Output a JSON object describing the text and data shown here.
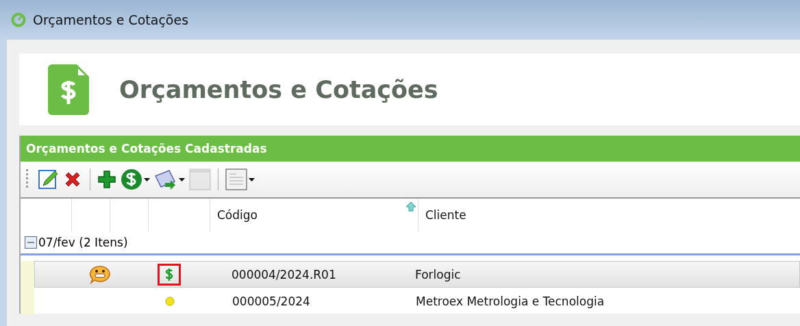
{
  "window": {
    "title": "Orçamentos e Cotações"
  },
  "header": {
    "title": "Orçamentos e Cotações"
  },
  "panel": {
    "title": "Orçamentos e Cotações Cadastradas"
  },
  "toolbar": [
    {
      "kind": "edit",
      "dropdown": false,
      "disabled": false
    },
    {
      "kind": "delete",
      "dropdown": false,
      "disabled": false
    },
    {
      "kind": "separator"
    },
    {
      "kind": "add",
      "dropdown": false,
      "disabled": false
    },
    {
      "kind": "money",
      "dropdown": true,
      "disabled": false
    },
    {
      "kind": "send",
      "dropdown": true,
      "disabled": false
    },
    {
      "kind": "blank",
      "dropdown": false,
      "disabled": true
    },
    {
      "kind": "separator"
    },
    {
      "kind": "document",
      "dropdown": true,
      "disabled": false
    }
  ],
  "table": {
    "columns": [
      {
        "label": "Código",
        "sorted": true
      },
      {
        "label": "Cliente",
        "sorted": false
      }
    ],
    "groups": [
      {
        "label": "07/fev (2 Itens)",
        "expanded": true,
        "rows": [
          {
            "selected": true,
            "highlighted": true,
            "mood_icon": {
              "kind": "emoticon"
            },
            "status_icon": {
              "kind": "money"
            },
            "code": "000004/2024.R01",
            "client": "Forlogic"
          },
          {
            "selected": false,
            "highlighted": false,
            "status_icon": {
              "kind": "dot"
            },
            "code": "000005/2024",
            "client": "Metroex Metrologia e Tecnologia"
          }
        ]
      }
    ]
  }
}
